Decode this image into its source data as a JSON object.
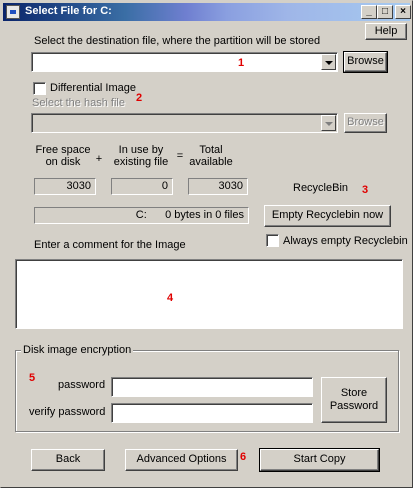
{
  "title": "Select File for C:",
  "caption_buttons": {
    "minimize": "_",
    "maximize": "□",
    "close": "×"
  },
  "help_label": "Help",
  "destination": {
    "label": "Select the destination file, where the partition will be stored",
    "value": "",
    "browse_label": "Browse"
  },
  "differential": {
    "label": "Differential Image",
    "checked": false
  },
  "hash": {
    "label": "Select the hash file",
    "value": "",
    "browse_label": "Browse"
  },
  "space": {
    "free_header": "Free space\non disk",
    "plus": "+",
    "inuse_header": "In use by\nexisting file",
    "equals": "=",
    "total_header": "Total\navailable",
    "free_value": "3030",
    "inuse_value": "0",
    "total_value": "3030"
  },
  "recycle": {
    "label": "RecycleBin",
    "drive_info": "C:      0 bytes in 0 files",
    "empty_button": "Empty Recyclebin now",
    "always_label": "Always empty Recyclebin",
    "always_checked": false
  },
  "comment": {
    "label": "Enter a comment for the Image",
    "value": ""
  },
  "encryption": {
    "group_label": "Disk image encryption",
    "password_label": "password",
    "verify_label": "verify password",
    "password_value": "",
    "verify_value": "",
    "store_button": "Store\nPassword"
  },
  "footer": {
    "back_label": "Back",
    "advanced_label": "Advanced Options",
    "start_label": "Start Copy"
  },
  "markers": [
    "1",
    "2",
    "3",
    "4",
    "5",
    "6"
  ]
}
